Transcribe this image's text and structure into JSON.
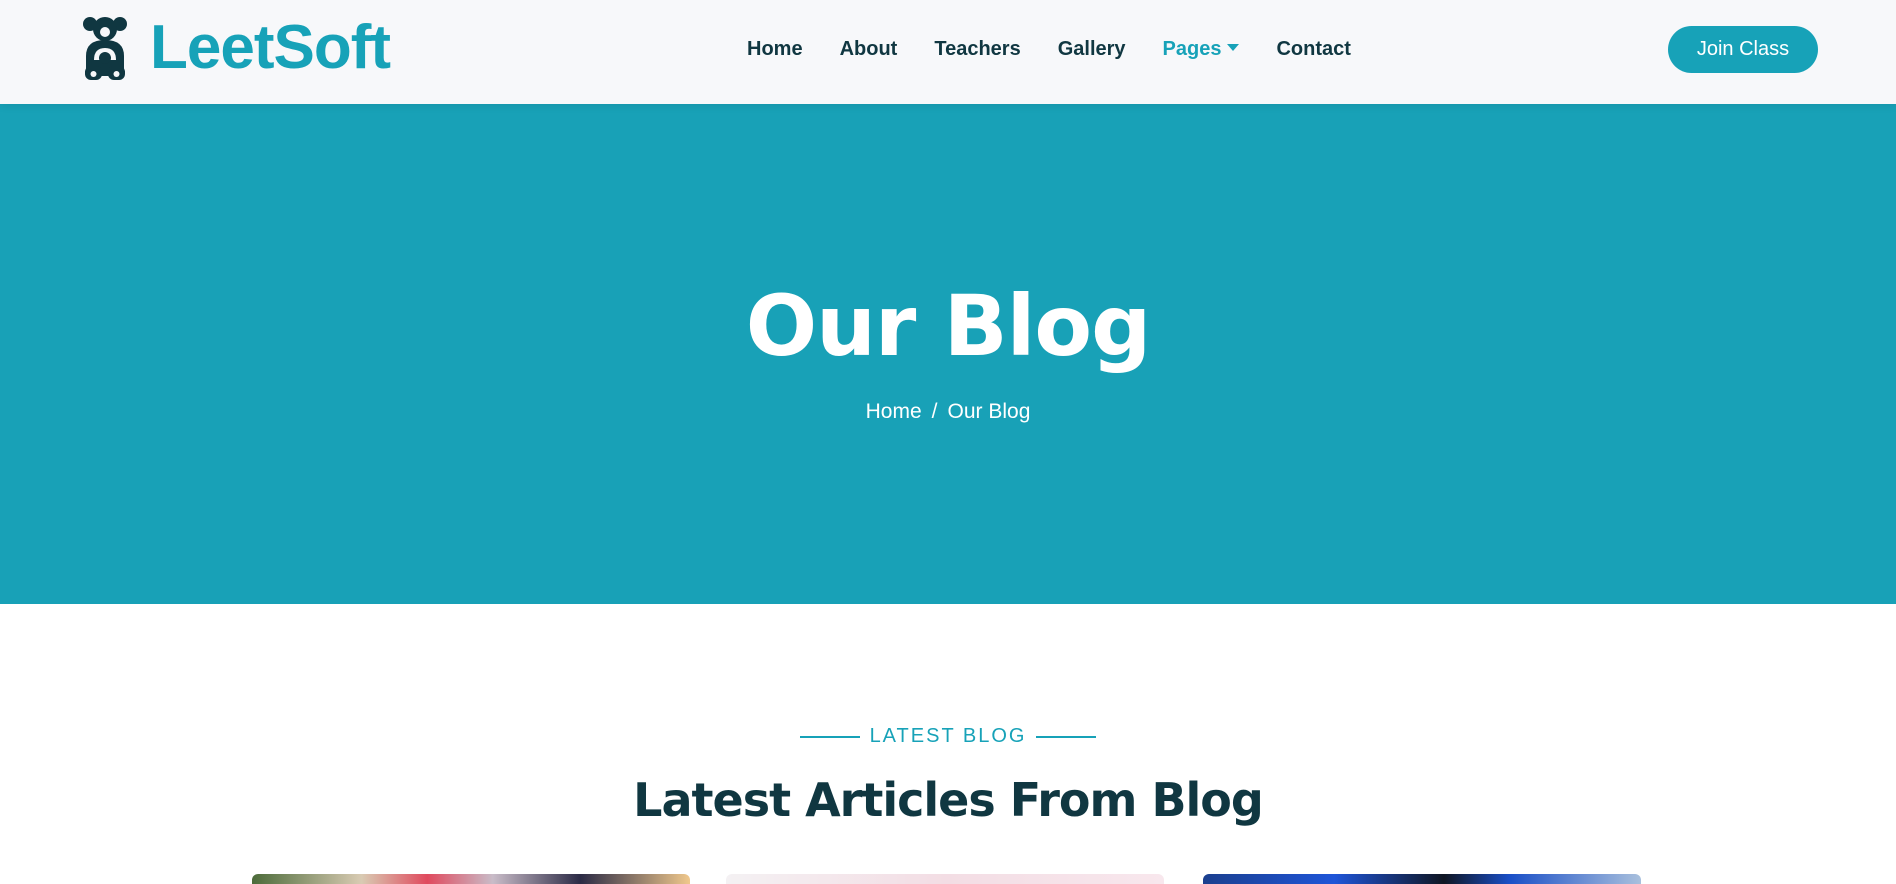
{
  "brand": {
    "name": "LeetSoft",
    "icon": "teddy-bear-icon"
  },
  "nav": {
    "links": [
      {
        "label": "Home",
        "active": false
      },
      {
        "label": "About",
        "active": false
      },
      {
        "label": "Teachers",
        "active": false
      },
      {
        "label": "Gallery",
        "active": false
      },
      {
        "label": "Pages",
        "active": true,
        "dropdown": true
      },
      {
        "label": "Contact",
        "active": false
      }
    ],
    "cta_label": "Join Class"
  },
  "hero": {
    "title": "Our Blog",
    "breadcrumb": {
      "home": "Home",
      "separator": "/",
      "current": "Our Blog"
    }
  },
  "blog": {
    "tag": "LATEST BLOG",
    "title": "Latest Articles From Blog"
  },
  "colors": {
    "primary": "#17a2b8",
    "hero_bg": "#18a1b7",
    "dark_text": "#103741",
    "navbar_bg": "#f7f8fa"
  }
}
